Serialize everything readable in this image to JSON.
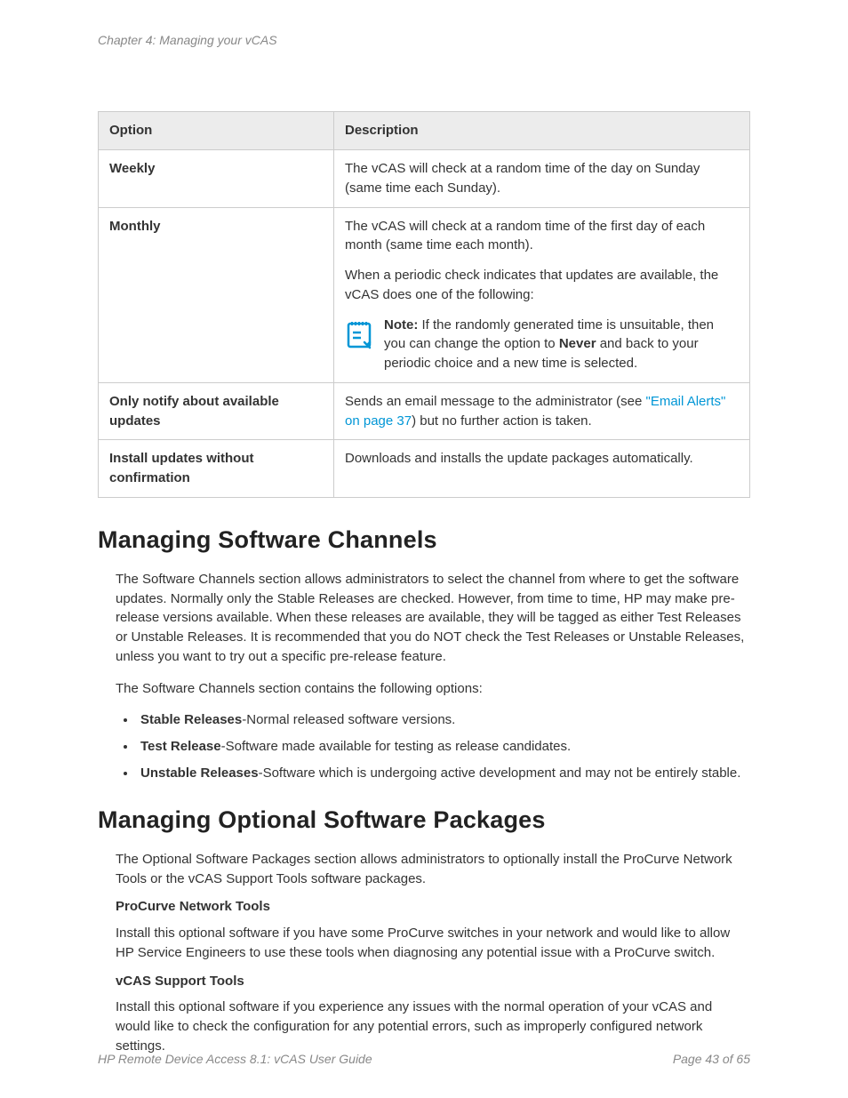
{
  "chapter_header": "Chapter 4: Managing your vCAS",
  "table": {
    "headers": {
      "option": "Option",
      "description": "Description"
    },
    "rows": {
      "weekly": {
        "option": "Weekly",
        "desc": "The vCAS will check at a random time of the day on Sunday (same time each Sunday)."
      },
      "monthly": {
        "option": "Monthly",
        "desc_p1": "The vCAS will check at a random time of the first day of each month (same time each month).",
        "desc_p2": "When a periodic check indicates that updates are available, the vCAS does one of the following:",
        "note_label": "Note:",
        "note_text_1": " If the randomly generated time is unsuitable, then you can change the option to ",
        "note_bold": "Never",
        "note_text_2": " and back to your periodic choice and a new time is selected."
      },
      "only_notify": {
        "option": "Only notify about available updates",
        "desc_1": "Sends an email message to the administrator (see ",
        "link": "\"Email Alerts\" on page 37",
        "desc_2": ") but no further action is taken."
      },
      "install_noconfirm": {
        "option": "Install updates without confirmation",
        "desc": "Downloads and installs the update packages automatically."
      }
    }
  },
  "section1": {
    "heading": "Managing Software Channels",
    "para1": "The Software Channels section allows administrators to select the channel from where to get the software updates. Normally only the Stable Releases are checked. However, from time to time, HP may make pre-release versions available. When these releases are available, they will be tagged as either Test Releases or Unstable Releases. It is recommended that you do NOT check the Test Releases or Unstable Releases, unless you want to try out a specific pre-release feature.",
    "para2": "The Software Channels section contains the following options:",
    "bullets": {
      "b1_bold": "Stable Releases",
      "b1_rest": "-Normal released software versions.",
      "b2_bold": "Test Release",
      "b2_rest": "-Software made available for testing as release candidates.",
      "b3_bold": "Unstable Releases",
      "b3_rest": "-Software which is undergoing active development and may not be entirely stable."
    }
  },
  "section2": {
    "heading": "Managing Optional Software Packages",
    "para1": "The Optional Software Packages section allows administrators to optionally install the ProCurve Network Tools or the vCAS Support Tools software packages.",
    "sub1_head": "ProCurve Network Tools",
    "sub1_para": "Install this optional software if you have some ProCurve switches in your network and would like to allow HP Service Engineers to use these tools when diagnosing any potential issue with a ProCurve switch.",
    "sub2_head": "vCAS Support Tools",
    "sub2_para": "Install this optional software if you experience any issues with the normal operation of your vCAS and would like to check the configuration for any potential errors, such as improperly configured network settings."
  },
  "footer": {
    "left": "HP Remote Device Access 8.1: vCAS User Guide",
    "right": "Page 43 of 65"
  }
}
